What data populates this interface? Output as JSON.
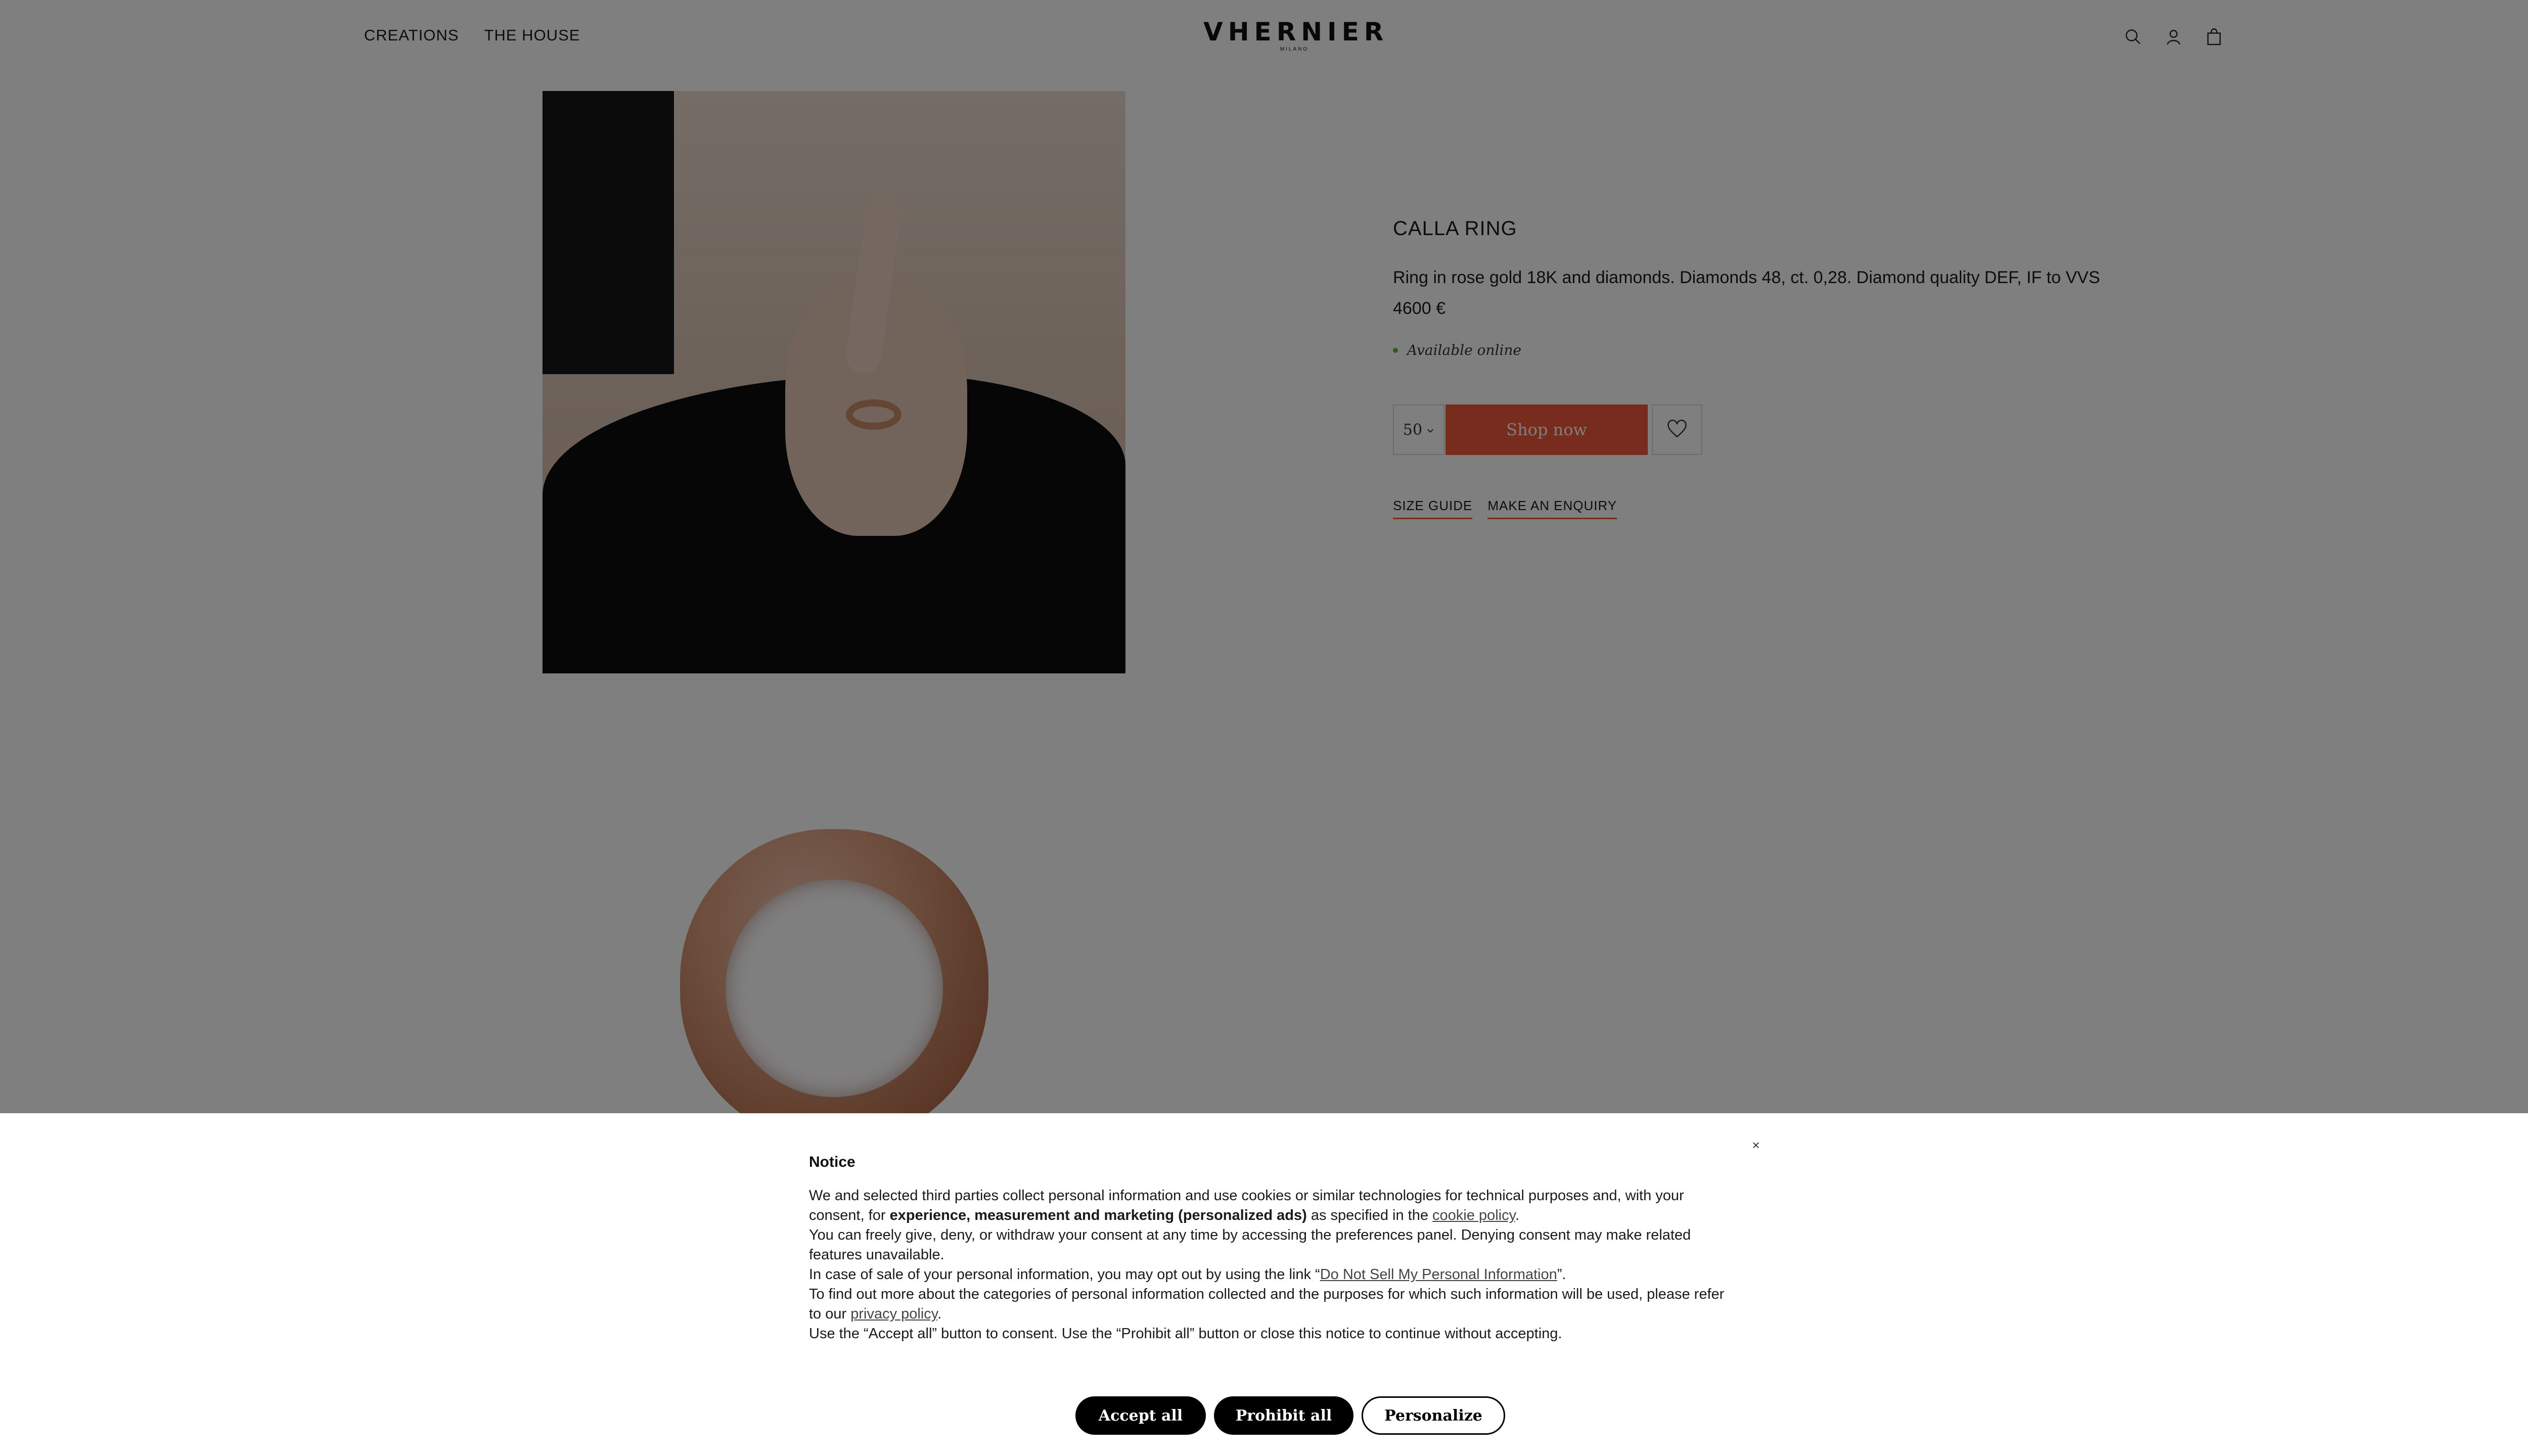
{
  "header": {
    "nav": [
      "CREATIONS",
      "THE HOUSE"
    ],
    "logo": "VHERNIER",
    "logo_sub": "MILANO",
    "icons": [
      "search-icon",
      "account-icon",
      "bag-icon"
    ]
  },
  "product": {
    "title": "CALLA RING",
    "description": "Ring in rose gold 18K and diamonds. Diamonds 48, ct. 0,28. Diamond quality DEF, IF to VVS",
    "price": "4600 €",
    "availability": "Available online",
    "size": "50",
    "shop_label": "Shop now",
    "links": [
      "SIZE GUIDE",
      "MAKE AN ENQUIRY"
    ],
    "accent": "#f0583b"
  },
  "notice": {
    "title": "Notice",
    "close": "×",
    "p1_a": "We and selected third parties collect personal information and use cookies or similar technologies for technical purposes and, with your consent, for ",
    "p1_bold": "experience, measurement and marketing (personalized ads)",
    "p1_c": " as specified in the ",
    "p1_link": "cookie policy",
    "p1_end": ".",
    "p2": "You can freely give, deny, or withdraw your consent at any time by accessing the preferences panel. Denying consent may make related features unavailable.",
    "p3_a": "In case of sale of your personal information, you may opt out by using the link “",
    "p3_link": "Do Not Sell My Personal Information",
    "p3_end": "”.",
    "p4_a": "To find out more about the categories of personal information collected and the purposes for which such information will be used, please refer to our ",
    "p4_link": "privacy policy",
    "p4_end": ".",
    "p5": "Use the “Accept all” button to consent. Use the “Prohibit all” button or close this notice to continue without accepting.",
    "buttons": {
      "accept": "Accept all",
      "prohibit": "Prohibit all",
      "personalize": "Personalize"
    }
  }
}
